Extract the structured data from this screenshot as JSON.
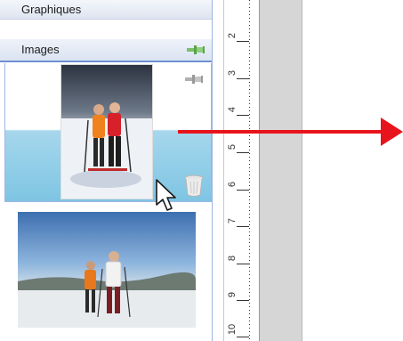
{
  "gallery": {
    "sections": [
      {
        "label": "Graphiques"
      },
      {
        "label": "Images"
      }
    ]
  },
  "ruler": {
    "numbers": [
      "2",
      "3",
      "4",
      "5",
      "6",
      "7",
      "8",
      "9",
      "10"
    ]
  },
  "icons": {
    "pin": "pin-icon",
    "trash": "trash-icon",
    "cursor": "mouse-cursor-icon"
  },
  "colors": {
    "arrow": "#e8141c",
    "selection": "#7ec5e3",
    "header_border": "#6f8fd1"
  }
}
